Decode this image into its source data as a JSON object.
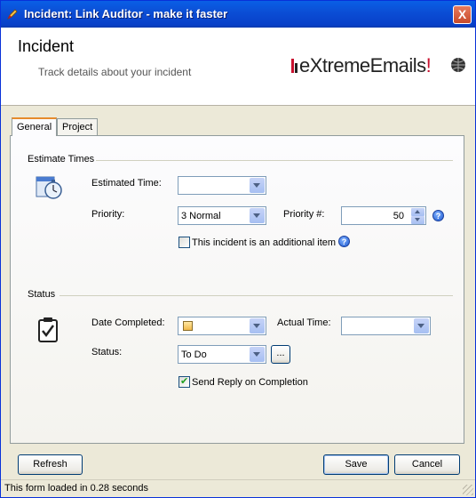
{
  "window": {
    "title": "Incident: Link Auditor - make it faster",
    "close_label": "X"
  },
  "header": {
    "title": "Incident",
    "subtitle": "Track details about your incident",
    "logo_prefix": "e",
    "logo_main": "XtremeEmails",
    "logo_suffix": "!"
  },
  "tabs": [
    {
      "label": "General"
    },
    {
      "label": "Project"
    }
  ],
  "estimate": {
    "group_label": "Estimate Times",
    "estimated_time_label": "Estimated Time:",
    "estimated_time_value": "",
    "priority_label": "Priority:",
    "priority_value": "3 Normal",
    "priority_num_label": "Priority #:",
    "priority_num_value": "50",
    "additional_label": "This incident is an additional item",
    "additional_checked": false
  },
  "status": {
    "group_label": "Status",
    "date_completed_label": "Date Completed:",
    "date_completed_value": "",
    "actual_time_label": "Actual Time:",
    "actual_time_value": "",
    "status_label": "Status:",
    "status_value": "To Do",
    "ellipsis_label": "...",
    "send_reply_label": "Send Reply on Completion",
    "send_reply_checked": true
  },
  "buttons": {
    "refresh": "Refresh",
    "save": "Save",
    "cancel": "Cancel"
  },
  "statusbar": {
    "text": "This form loaded in 0.28 seconds"
  },
  "colors": {
    "title_bar": "#0a5fe6",
    "tab_highlight": "#e68b2c",
    "logo_red": "#c8102e"
  }
}
